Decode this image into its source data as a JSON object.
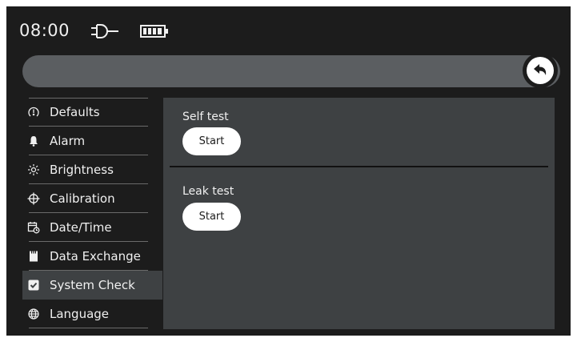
{
  "status": {
    "time": "08:00",
    "power_icon": "plug-icon",
    "battery_icon": "battery-icon"
  },
  "title_bar": {
    "title": "",
    "back_icon": "undo-arrow-icon"
  },
  "menu": {
    "items": [
      {
        "label": "Defaults",
        "icon": "defaults-icon",
        "active": false
      },
      {
        "label": "Alarm",
        "icon": "bell-icon",
        "active": false
      },
      {
        "label": "Brightness",
        "icon": "sun-icon",
        "active": false
      },
      {
        "label": "Calibration",
        "icon": "crosshair-icon",
        "active": false
      },
      {
        "label": "Date/Time",
        "icon": "calendar-clock-icon",
        "active": false
      },
      {
        "label": "Data Exchange",
        "icon": "sd-card-icon",
        "active": false
      },
      {
        "label": "System Check",
        "icon": "checkbox-icon",
        "active": true
      },
      {
        "label": "Language",
        "icon": "globe-icon",
        "active": false
      }
    ]
  },
  "system_check": {
    "self_test": {
      "title": "Self test",
      "button_label": "Start"
    },
    "leak_test": {
      "title": "Leak test",
      "button_label": "Start"
    }
  },
  "colors": {
    "background": "#1c1c1c",
    "title_bar": "#5b5e61",
    "panel": "#3e4143",
    "text": "#f0f0f0",
    "button": "#ffffff"
  }
}
